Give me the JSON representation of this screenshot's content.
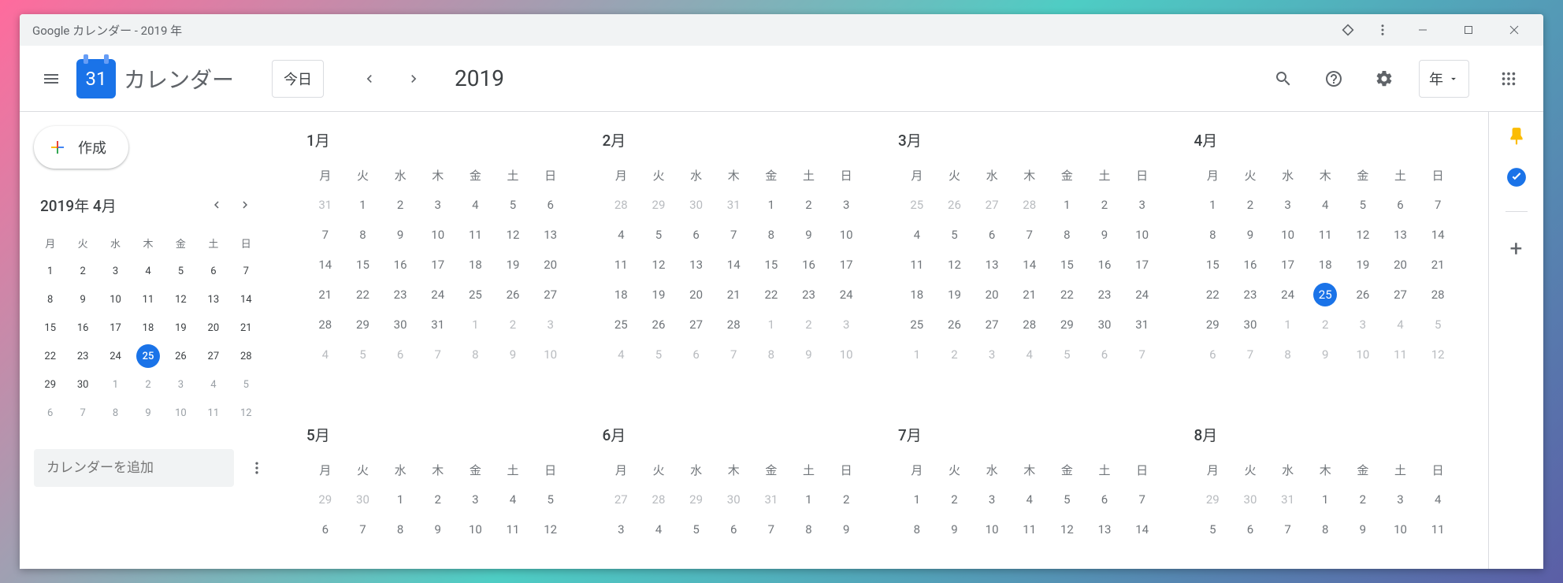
{
  "window": {
    "title": "Google カレンダー - 2019 年"
  },
  "header": {
    "logo_day": "31",
    "app_name": "カレンダー",
    "today": "今日",
    "year": "2019",
    "view": "年"
  },
  "sidebar": {
    "create": "作成",
    "mini_title": "2019年 4月",
    "dow": [
      "月",
      "火",
      "水",
      "木",
      "金",
      "土",
      "日"
    ],
    "mini_weeks": [
      [
        {
          "d": "1"
        },
        {
          "d": "2"
        },
        {
          "d": "3"
        },
        {
          "d": "4"
        },
        {
          "d": "5"
        },
        {
          "d": "6"
        },
        {
          "d": "7"
        }
      ],
      [
        {
          "d": "8"
        },
        {
          "d": "9"
        },
        {
          "d": "10"
        },
        {
          "d": "11"
        },
        {
          "d": "12"
        },
        {
          "d": "13"
        },
        {
          "d": "14"
        }
      ],
      [
        {
          "d": "15"
        },
        {
          "d": "16"
        },
        {
          "d": "17"
        },
        {
          "d": "18"
        },
        {
          "d": "19"
        },
        {
          "d": "20"
        },
        {
          "d": "21"
        }
      ],
      [
        {
          "d": "22"
        },
        {
          "d": "23"
        },
        {
          "d": "24"
        },
        {
          "d": "25",
          "t": true
        },
        {
          "d": "26"
        },
        {
          "d": "27"
        },
        {
          "d": "28"
        }
      ],
      [
        {
          "d": "29"
        },
        {
          "d": "30"
        },
        {
          "d": "1",
          "m": true
        },
        {
          "d": "2",
          "m": true
        },
        {
          "d": "3",
          "m": true
        },
        {
          "d": "4",
          "m": true
        },
        {
          "d": "5",
          "m": true
        }
      ],
      [
        {
          "d": "6",
          "m": true
        },
        {
          "d": "7",
          "m": true
        },
        {
          "d": "8",
          "m": true
        },
        {
          "d": "9",
          "m": true
        },
        {
          "d": "10",
          "m": true
        },
        {
          "d": "11",
          "m": true
        },
        {
          "d": "12",
          "m": true
        }
      ]
    ],
    "add_calendar": "カレンダーを追加"
  },
  "dow": [
    "月",
    "火",
    "水",
    "木",
    "金",
    "土",
    "日"
  ],
  "months": [
    {
      "title": "1月",
      "weeks": [
        [
          {
            "d": "31",
            "m": true
          },
          {
            "d": "1"
          },
          {
            "d": "2"
          },
          {
            "d": "3"
          },
          {
            "d": "4"
          },
          {
            "d": "5"
          },
          {
            "d": "6"
          }
        ],
        [
          {
            "d": "7"
          },
          {
            "d": "8"
          },
          {
            "d": "9"
          },
          {
            "d": "10"
          },
          {
            "d": "11"
          },
          {
            "d": "12"
          },
          {
            "d": "13"
          }
        ],
        [
          {
            "d": "14"
          },
          {
            "d": "15"
          },
          {
            "d": "16"
          },
          {
            "d": "17"
          },
          {
            "d": "18"
          },
          {
            "d": "19"
          },
          {
            "d": "20"
          }
        ],
        [
          {
            "d": "21"
          },
          {
            "d": "22"
          },
          {
            "d": "23"
          },
          {
            "d": "24"
          },
          {
            "d": "25"
          },
          {
            "d": "26"
          },
          {
            "d": "27"
          }
        ],
        [
          {
            "d": "28"
          },
          {
            "d": "29"
          },
          {
            "d": "30"
          },
          {
            "d": "31"
          },
          {
            "d": "1",
            "m": true
          },
          {
            "d": "2",
            "m": true
          },
          {
            "d": "3",
            "m": true
          }
        ],
        [
          {
            "d": "4",
            "m": true
          },
          {
            "d": "5",
            "m": true
          },
          {
            "d": "6",
            "m": true
          },
          {
            "d": "7",
            "m": true
          },
          {
            "d": "8",
            "m": true
          },
          {
            "d": "9",
            "m": true
          },
          {
            "d": "10",
            "m": true
          }
        ]
      ]
    },
    {
      "title": "2月",
      "weeks": [
        [
          {
            "d": "28",
            "m": true
          },
          {
            "d": "29",
            "m": true
          },
          {
            "d": "30",
            "m": true
          },
          {
            "d": "31",
            "m": true
          },
          {
            "d": "1"
          },
          {
            "d": "2"
          },
          {
            "d": "3"
          }
        ],
        [
          {
            "d": "4"
          },
          {
            "d": "5"
          },
          {
            "d": "6"
          },
          {
            "d": "7"
          },
          {
            "d": "8"
          },
          {
            "d": "9"
          },
          {
            "d": "10"
          }
        ],
        [
          {
            "d": "11"
          },
          {
            "d": "12"
          },
          {
            "d": "13"
          },
          {
            "d": "14"
          },
          {
            "d": "15"
          },
          {
            "d": "16"
          },
          {
            "d": "17"
          }
        ],
        [
          {
            "d": "18"
          },
          {
            "d": "19"
          },
          {
            "d": "20"
          },
          {
            "d": "21"
          },
          {
            "d": "22"
          },
          {
            "d": "23"
          },
          {
            "d": "24"
          }
        ],
        [
          {
            "d": "25"
          },
          {
            "d": "26"
          },
          {
            "d": "27"
          },
          {
            "d": "28"
          },
          {
            "d": "1",
            "m": true
          },
          {
            "d": "2",
            "m": true
          },
          {
            "d": "3",
            "m": true
          }
        ],
        [
          {
            "d": "4",
            "m": true
          },
          {
            "d": "5",
            "m": true
          },
          {
            "d": "6",
            "m": true
          },
          {
            "d": "7",
            "m": true
          },
          {
            "d": "8",
            "m": true
          },
          {
            "d": "9",
            "m": true
          },
          {
            "d": "10",
            "m": true
          }
        ]
      ]
    },
    {
      "title": "3月",
      "weeks": [
        [
          {
            "d": "25",
            "m": true
          },
          {
            "d": "26",
            "m": true
          },
          {
            "d": "27",
            "m": true
          },
          {
            "d": "28",
            "m": true
          },
          {
            "d": "1"
          },
          {
            "d": "2"
          },
          {
            "d": "3"
          }
        ],
        [
          {
            "d": "4"
          },
          {
            "d": "5"
          },
          {
            "d": "6"
          },
          {
            "d": "7"
          },
          {
            "d": "8"
          },
          {
            "d": "9"
          },
          {
            "d": "10"
          }
        ],
        [
          {
            "d": "11"
          },
          {
            "d": "12"
          },
          {
            "d": "13"
          },
          {
            "d": "14"
          },
          {
            "d": "15"
          },
          {
            "d": "16"
          },
          {
            "d": "17"
          }
        ],
        [
          {
            "d": "18"
          },
          {
            "d": "19"
          },
          {
            "d": "20"
          },
          {
            "d": "21"
          },
          {
            "d": "22"
          },
          {
            "d": "23"
          },
          {
            "d": "24"
          }
        ],
        [
          {
            "d": "25"
          },
          {
            "d": "26"
          },
          {
            "d": "27"
          },
          {
            "d": "28"
          },
          {
            "d": "29"
          },
          {
            "d": "30"
          },
          {
            "d": "31"
          }
        ],
        [
          {
            "d": "1",
            "m": true
          },
          {
            "d": "2",
            "m": true
          },
          {
            "d": "3",
            "m": true
          },
          {
            "d": "4",
            "m": true
          },
          {
            "d": "5",
            "m": true
          },
          {
            "d": "6",
            "m": true
          },
          {
            "d": "7",
            "m": true
          }
        ]
      ]
    },
    {
      "title": "4月",
      "weeks": [
        [
          {
            "d": "1"
          },
          {
            "d": "2"
          },
          {
            "d": "3"
          },
          {
            "d": "4"
          },
          {
            "d": "5"
          },
          {
            "d": "6"
          },
          {
            "d": "7"
          }
        ],
        [
          {
            "d": "8"
          },
          {
            "d": "9"
          },
          {
            "d": "10"
          },
          {
            "d": "11"
          },
          {
            "d": "12"
          },
          {
            "d": "13"
          },
          {
            "d": "14"
          }
        ],
        [
          {
            "d": "15"
          },
          {
            "d": "16"
          },
          {
            "d": "17"
          },
          {
            "d": "18"
          },
          {
            "d": "19"
          },
          {
            "d": "20"
          },
          {
            "d": "21"
          }
        ],
        [
          {
            "d": "22"
          },
          {
            "d": "23"
          },
          {
            "d": "24"
          },
          {
            "d": "25",
            "t": true
          },
          {
            "d": "26"
          },
          {
            "d": "27"
          },
          {
            "d": "28"
          }
        ],
        [
          {
            "d": "29"
          },
          {
            "d": "30"
          },
          {
            "d": "1",
            "m": true
          },
          {
            "d": "2",
            "m": true
          },
          {
            "d": "3",
            "m": true
          },
          {
            "d": "4",
            "m": true
          },
          {
            "d": "5",
            "m": true
          }
        ],
        [
          {
            "d": "6",
            "m": true
          },
          {
            "d": "7",
            "m": true
          },
          {
            "d": "8",
            "m": true
          },
          {
            "d": "9",
            "m": true
          },
          {
            "d": "10",
            "m": true
          },
          {
            "d": "11",
            "m": true
          },
          {
            "d": "12",
            "m": true
          }
        ]
      ]
    },
    {
      "title": "5月",
      "weeks": [
        [
          {
            "d": "29",
            "m": true
          },
          {
            "d": "30",
            "m": true
          },
          {
            "d": "1"
          },
          {
            "d": "2"
          },
          {
            "d": "3"
          },
          {
            "d": "4"
          },
          {
            "d": "5"
          }
        ],
        [
          {
            "d": "6"
          },
          {
            "d": "7"
          },
          {
            "d": "8"
          },
          {
            "d": "9"
          },
          {
            "d": "10"
          },
          {
            "d": "11"
          },
          {
            "d": "12"
          }
        ]
      ]
    },
    {
      "title": "6月",
      "weeks": [
        [
          {
            "d": "27",
            "m": true
          },
          {
            "d": "28",
            "m": true
          },
          {
            "d": "29",
            "m": true
          },
          {
            "d": "30",
            "m": true
          },
          {
            "d": "31",
            "m": true
          },
          {
            "d": "1"
          },
          {
            "d": "2"
          }
        ],
        [
          {
            "d": "3"
          },
          {
            "d": "4"
          },
          {
            "d": "5"
          },
          {
            "d": "6"
          },
          {
            "d": "7"
          },
          {
            "d": "8"
          },
          {
            "d": "9"
          }
        ]
      ]
    },
    {
      "title": "7月",
      "weeks": [
        [
          {
            "d": "1"
          },
          {
            "d": "2"
          },
          {
            "d": "3"
          },
          {
            "d": "4"
          },
          {
            "d": "5"
          },
          {
            "d": "6"
          },
          {
            "d": "7"
          }
        ],
        [
          {
            "d": "8"
          },
          {
            "d": "9"
          },
          {
            "d": "10"
          },
          {
            "d": "11"
          },
          {
            "d": "12"
          },
          {
            "d": "13"
          },
          {
            "d": "14"
          }
        ]
      ]
    },
    {
      "title": "8月",
      "weeks": [
        [
          {
            "d": "29",
            "m": true
          },
          {
            "d": "30",
            "m": true
          },
          {
            "d": "31",
            "m": true
          },
          {
            "d": "1"
          },
          {
            "d": "2"
          },
          {
            "d": "3"
          },
          {
            "d": "4"
          }
        ],
        [
          {
            "d": "5"
          },
          {
            "d": "6"
          },
          {
            "d": "7"
          },
          {
            "d": "8"
          },
          {
            "d": "9"
          },
          {
            "d": "10"
          },
          {
            "d": "11"
          }
        ]
      ]
    }
  ]
}
